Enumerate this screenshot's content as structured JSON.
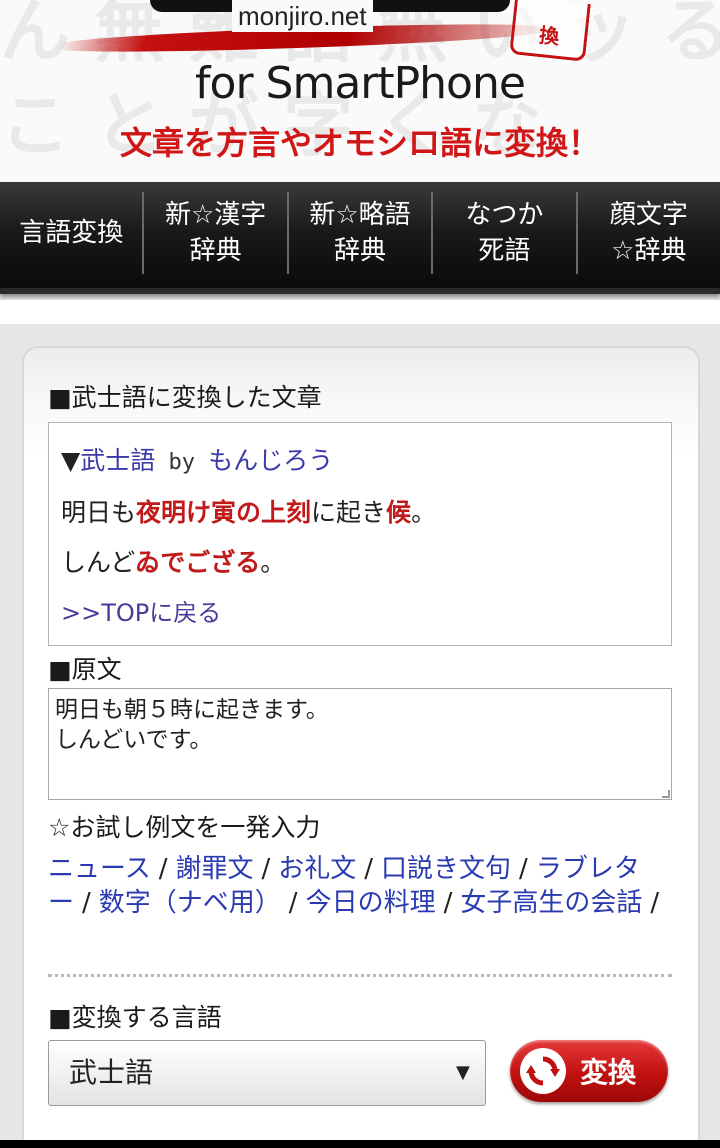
{
  "header": {
    "domain": "monjiro.net",
    "tagline": "for SmartPhone",
    "subtitle": "文章を方言やオモシロ語に変換！",
    "stamp": "換",
    "bg_text": [
      "ん 無 難 語 無 い ッ る",
      "こ と が 字 く な"
    ]
  },
  "nav": {
    "items": [
      {
        "label": "言語変換"
      },
      {
        "label": "新☆漢字\n辞典"
      },
      {
        "label": "新☆略語\n辞典"
      },
      {
        "label": "なつか\n死語"
      },
      {
        "label": "顔文字\n☆辞典"
      }
    ]
  },
  "result": {
    "section_title": "■武士語に変換した文章",
    "head_prefix": "▼",
    "lang_link": "武士語",
    "by": " by ",
    "author": "もんじろう",
    "line1": {
      "a": "明日も",
      "b": "夜明け寅の上刻",
      "c": "に起き",
      "d": "候",
      "e": "。"
    },
    "line2": {
      "a": "しんど",
      "b": "ゐでござる",
      "c": "。"
    },
    "back_link": ">>TOPに戻る"
  },
  "original": {
    "section_title": "■原文",
    "text": "明日も朝５時に起きます。\nしんどいです。"
  },
  "examples": {
    "title": "☆お試し例文を一発入力",
    "links": [
      "ニュース",
      "謝罪文",
      "お礼文",
      "口説き文句",
      "ラブレター",
      "数字（ナベ用）",
      "今日の料理",
      "女子高生の会話"
    ],
    "separator": "/"
  },
  "language": {
    "section_title": "■変換する言語",
    "selected": "武士語",
    "arrow": "▼",
    "convert_label": "変換"
  },
  "colors": {
    "accent_red": "#d01616",
    "link_blue": "#2a3ab0",
    "nav_bg": "#1a1a1a"
  }
}
